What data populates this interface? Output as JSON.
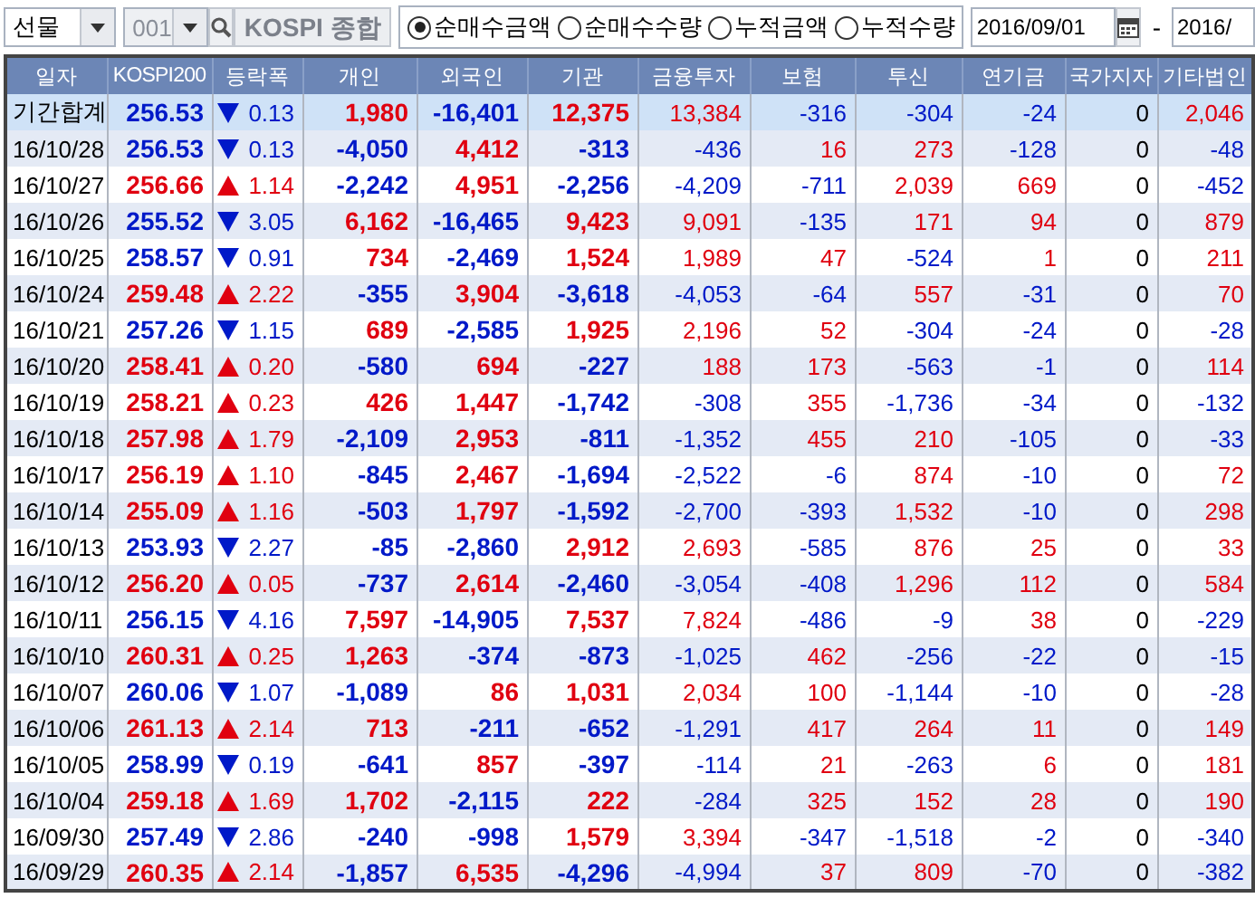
{
  "toolbar": {
    "market": {
      "value": "선물"
    },
    "code": {
      "value": "001",
      "disabled": true
    },
    "index_name": "KOSPI 종합",
    "modes": [
      {
        "label": "순매수금액",
        "selected": true
      },
      {
        "label": "순매수수량",
        "selected": false
      },
      {
        "label": "누적금액",
        "selected": false
      },
      {
        "label": "누적수량",
        "selected": false
      }
    ],
    "start_date": "2016/09/01",
    "separator": "-",
    "end_date": "2016/"
  },
  "table": {
    "columns": [
      "일자",
      "KOSPI200",
      "등락폭",
      "개인",
      "외국인",
      "기관",
      "금융투자",
      "보험",
      "투신",
      "연기금",
      "국가지자",
      "기타법인"
    ],
    "rows": [
      {
        "kind": "total",
        "date": "기간합계",
        "kospi200": "256.53",
        "rising": false,
        "change": "0.13",
        "values": [
          "1,980",
          "-16,401",
          "12,375",
          "13,384",
          "-316",
          "-304",
          "-24",
          "0",
          "2,046"
        ]
      },
      {
        "kind": "day",
        "date": "16/10/28",
        "kospi200": "256.53",
        "rising": false,
        "change": "0.13",
        "values": [
          "-4,050",
          "4,412",
          "-313",
          "-436",
          "16",
          "273",
          "-128",
          "0",
          "-48"
        ]
      },
      {
        "kind": "day",
        "date": "16/10/27",
        "kospi200": "256.66",
        "rising": true,
        "change": "1.14",
        "values": [
          "-2,242",
          "4,951",
          "-2,256",
          "-4,209",
          "-711",
          "2,039",
          "669",
          "0",
          "-452"
        ]
      },
      {
        "kind": "day",
        "date": "16/10/26",
        "kospi200": "255.52",
        "rising": false,
        "change": "3.05",
        "values": [
          "6,162",
          "-16,465",
          "9,423",
          "9,091",
          "-135",
          "171",
          "94",
          "0",
          "879"
        ]
      },
      {
        "kind": "day",
        "date": "16/10/25",
        "kospi200": "258.57",
        "rising": false,
        "change": "0.91",
        "values": [
          "734",
          "-2,469",
          "1,524",
          "1,989",
          "47",
          "-524",
          "1",
          "0",
          "211"
        ]
      },
      {
        "kind": "day",
        "date": "16/10/24",
        "kospi200": "259.48",
        "rising": true,
        "change": "2.22",
        "values": [
          "-355",
          "3,904",
          "-3,618",
          "-4,053",
          "-64",
          "557",
          "-31",
          "0",
          "70"
        ]
      },
      {
        "kind": "day",
        "date": "16/10/21",
        "kospi200": "257.26",
        "rising": false,
        "change": "1.15",
        "values": [
          "689",
          "-2,585",
          "1,925",
          "2,196",
          "52",
          "-304",
          "-24",
          "0",
          "-28"
        ]
      },
      {
        "kind": "day",
        "date": "16/10/20",
        "kospi200": "258.41",
        "rising": true,
        "change": "0.20",
        "values": [
          "-580",
          "694",
          "-227",
          "188",
          "173",
          "-563",
          "-1",
          "0",
          "114"
        ]
      },
      {
        "kind": "day",
        "date": "16/10/19",
        "kospi200": "258.21",
        "rising": true,
        "change": "0.23",
        "values": [
          "426",
          "1,447",
          "-1,742",
          "-308",
          "355",
          "-1,736",
          "-34",
          "0",
          "-132"
        ]
      },
      {
        "kind": "day",
        "date": "16/10/18",
        "kospi200": "257.98",
        "rising": true,
        "change": "1.79",
        "values": [
          "-2,109",
          "2,953",
          "-811",
          "-1,352",
          "455",
          "210",
          "-105",
          "0",
          "-33"
        ]
      },
      {
        "kind": "day",
        "date": "16/10/17",
        "kospi200": "256.19",
        "rising": true,
        "change": "1.10",
        "values": [
          "-845",
          "2,467",
          "-1,694",
          "-2,522",
          "-6",
          "874",
          "-10",
          "0",
          "72"
        ]
      },
      {
        "kind": "day",
        "date": "16/10/14",
        "kospi200": "255.09",
        "rising": true,
        "change": "1.16",
        "values": [
          "-503",
          "1,797",
          "-1,592",
          "-2,700",
          "-393",
          "1,532",
          "-10",
          "0",
          "298"
        ]
      },
      {
        "kind": "day",
        "date": "16/10/13",
        "kospi200": "253.93",
        "rising": false,
        "change": "2.27",
        "values": [
          "-85",
          "-2,860",
          "2,912",
          "2,693",
          "-585",
          "876",
          "25",
          "0",
          "33"
        ]
      },
      {
        "kind": "day",
        "date": "16/10/12",
        "kospi200": "256.20",
        "rising": true,
        "change": "0.05",
        "values": [
          "-737",
          "2,614",
          "-2,460",
          "-3,054",
          "-408",
          "1,296",
          "112",
          "0",
          "584"
        ]
      },
      {
        "kind": "day",
        "date": "16/10/11",
        "kospi200": "256.15",
        "rising": false,
        "change": "4.16",
        "values": [
          "7,597",
          "-14,905",
          "7,537",
          "7,824",
          "-486",
          "-9",
          "38",
          "0",
          "-229"
        ]
      },
      {
        "kind": "day",
        "date": "16/10/10",
        "kospi200": "260.31",
        "rising": true,
        "change": "0.25",
        "values": [
          "1,263",
          "-374",
          "-873",
          "-1,025",
          "462",
          "-256",
          "-22",
          "0",
          "-15"
        ]
      },
      {
        "kind": "day",
        "date": "16/10/07",
        "kospi200": "260.06",
        "rising": false,
        "change": "1.07",
        "values": [
          "-1,089",
          "86",
          "1,031",
          "2,034",
          "100",
          "-1,144",
          "-10",
          "0",
          "-28"
        ]
      },
      {
        "kind": "day",
        "date": "16/10/06",
        "kospi200": "261.13",
        "rising": true,
        "change": "2.14",
        "values": [
          "713",
          "-211",
          "-652",
          "-1,291",
          "417",
          "264",
          "11",
          "0",
          "149"
        ]
      },
      {
        "kind": "day",
        "date": "16/10/05",
        "kospi200": "258.99",
        "rising": false,
        "change": "0.19",
        "values": [
          "-641",
          "857",
          "-397",
          "-114",
          "21",
          "-263",
          "6",
          "0",
          "181"
        ]
      },
      {
        "kind": "day",
        "date": "16/10/04",
        "kospi200": "259.18",
        "rising": true,
        "change": "1.69",
        "values": [
          "1,702",
          "-2,115",
          "222",
          "-284",
          "325",
          "152",
          "28",
          "0",
          "190"
        ]
      },
      {
        "kind": "day",
        "date": "16/09/30",
        "kospi200": "257.49",
        "rising": false,
        "change": "2.86",
        "values": [
          "-240",
          "-998",
          "1,579",
          "3,394",
          "-347",
          "-1,518",
          "-2",
          "0",
          "-340"
        ]
      },
      {
        "kind": "day",
        "date": "16/09/29",
        "kospi200": "260.35",
        "rising": true,
        "change": "2.14",
        "values": [
          "-1,857",
          "6,535",
          "-4,296",
          "-4,994",
          "37",
          "809",
          "-70",
          "0",
          "-382"
        ]
      }
    ]
  }
}
